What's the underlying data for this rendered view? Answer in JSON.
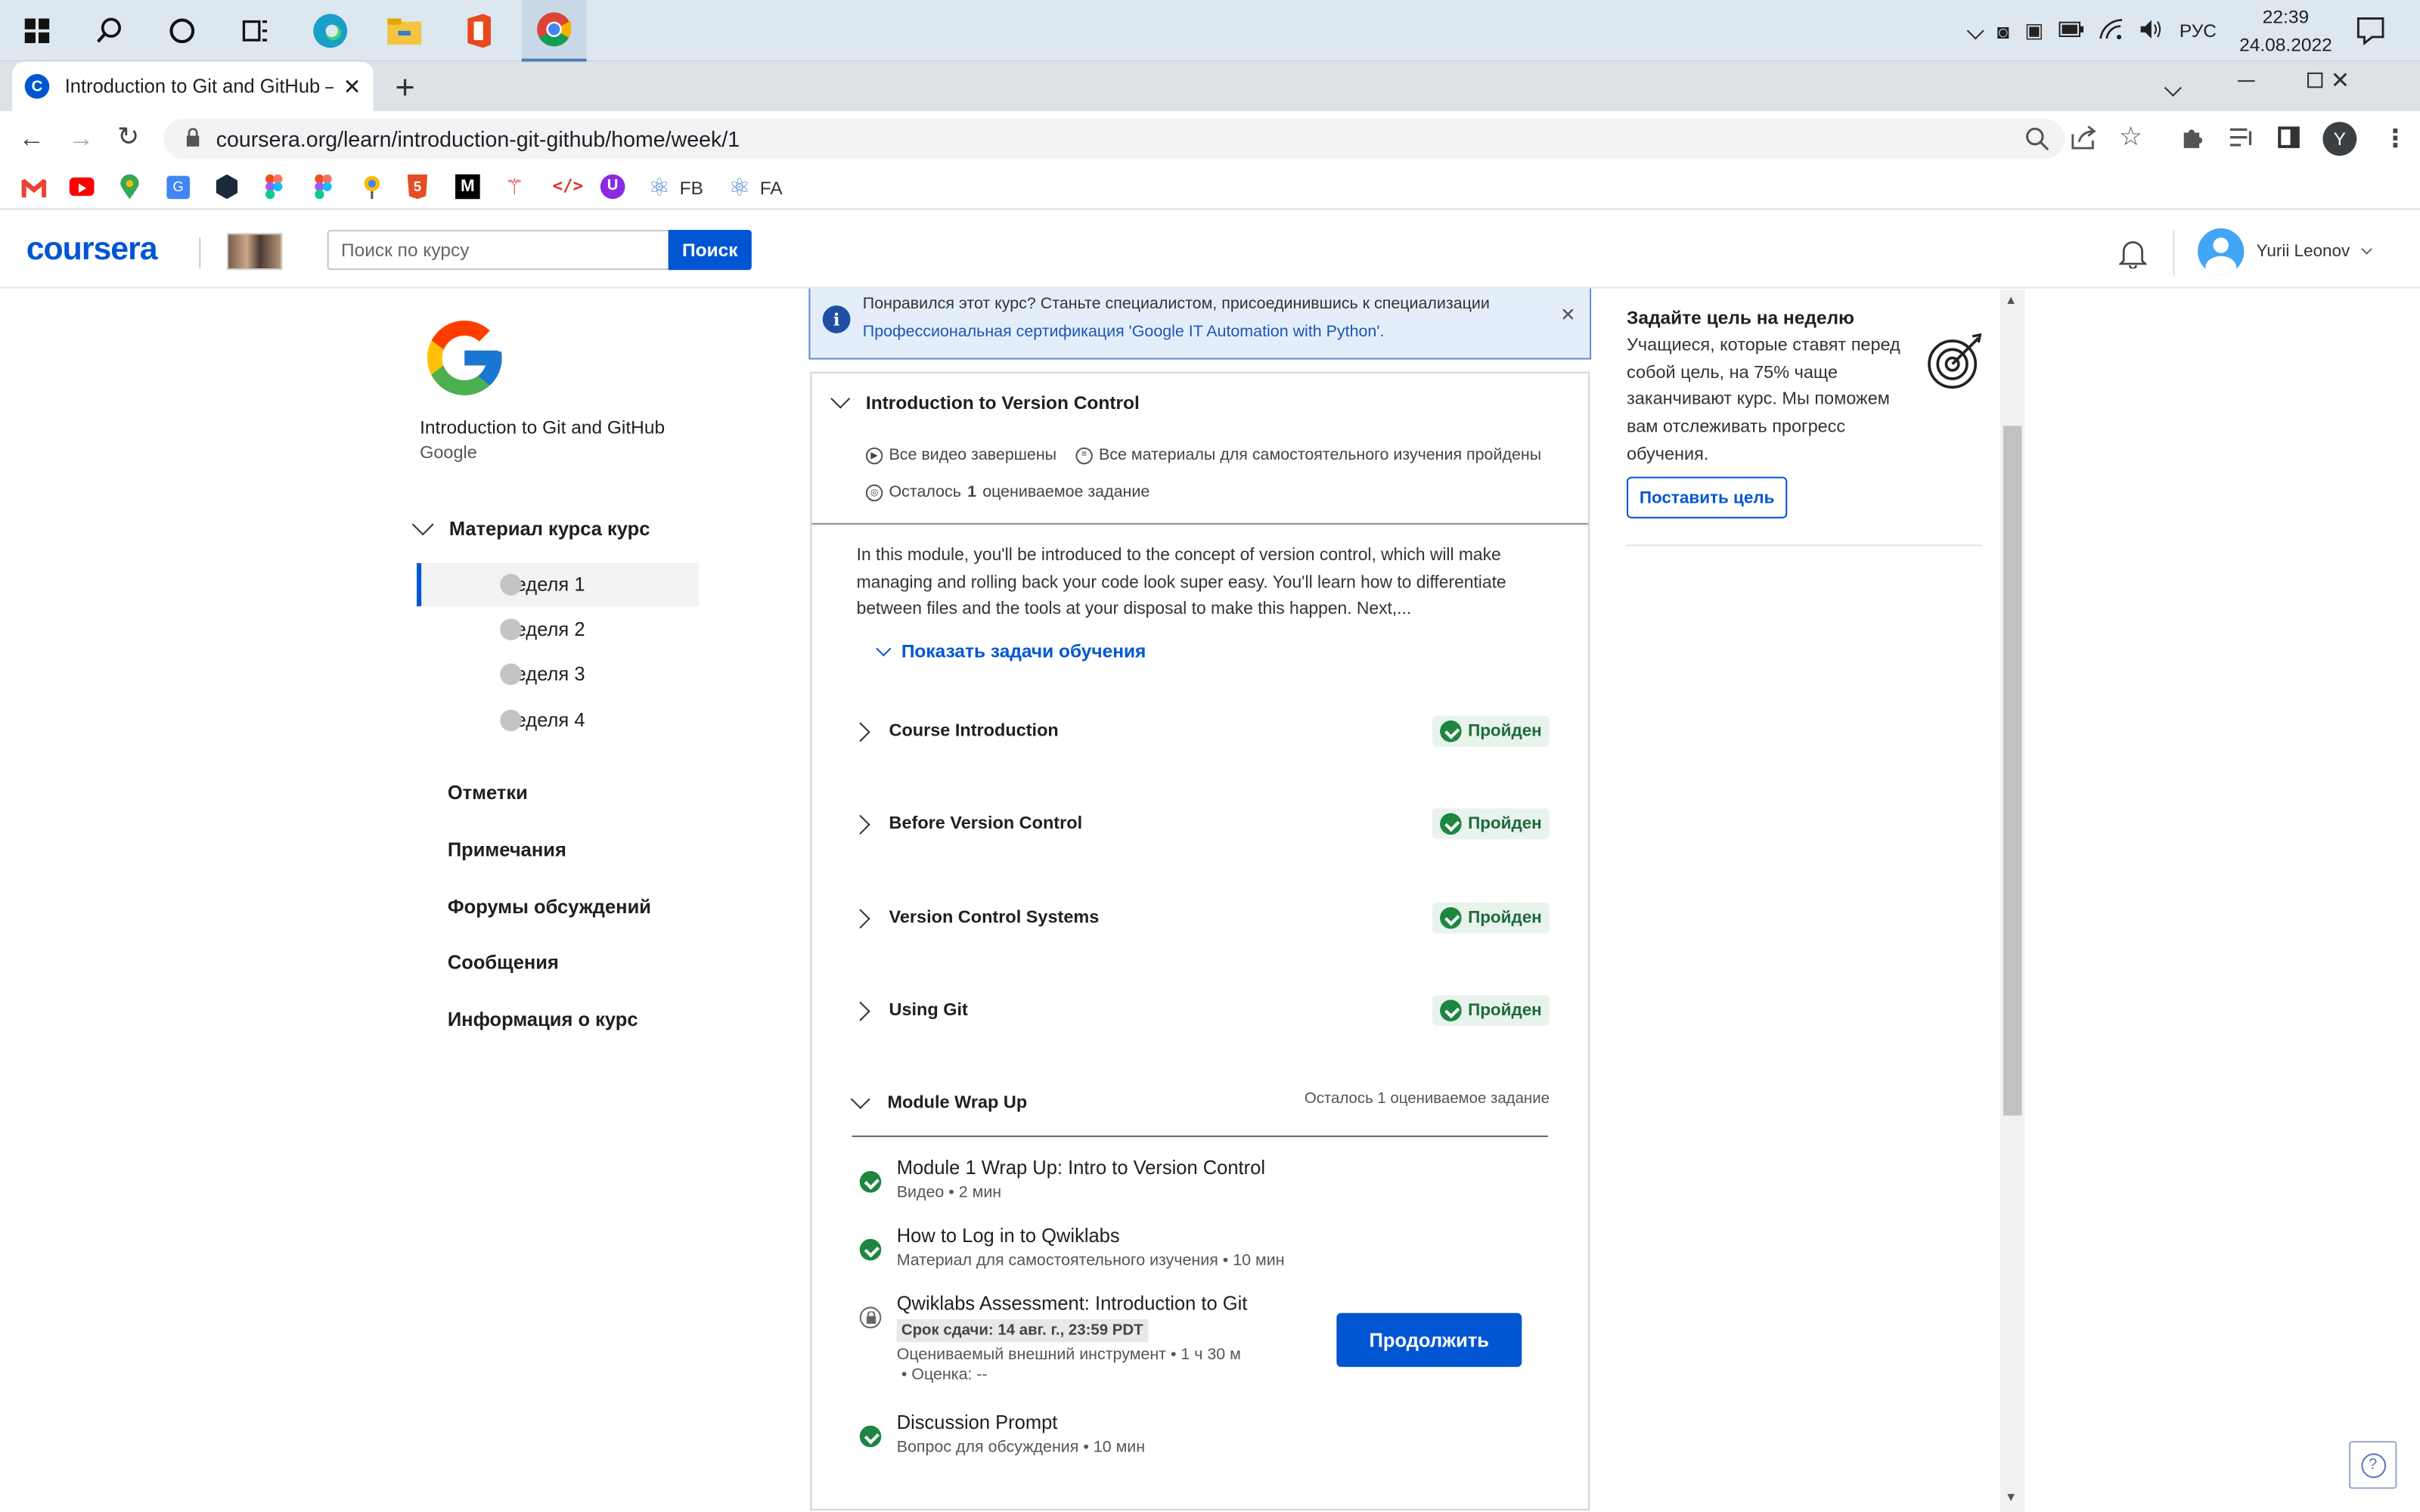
{
  "taskbar": {
    "language": "РУС",
    "time": "22:39",
    "date": "24.08.2022"
  },
  "browser": {
    "tab_title": "Introduction to Git and GitHub –",
    "url": "coursera.org/learn/introduction-git-github/home/week/1",
    "profile_initial": "Y",
    "bookmarks": [
      {
        "icon": "gmail-icon",
        "label": ""
      },
      {
        "icon": "youtube-icon",
        "label": ""
      },
      {
        "icon": "maps-icon",
        "label": ""
      },
      {
        "icon": "translate-icon",
        "label": ""
      },
      {
        "icon": "codepen-icon",
        "label": ""
      },
      {
        "icon": "figma-icon",
        "label": ""
      },
      {
        "icon": "figma-icon",
        "label": ""
      },
      {
        "icon": "pin-icon",
        "label": ""
      },
      {
        "icon": "html5-icon",
        "label": ""
      },
      {
        "icon": "medium-icon",
        "label": ""
      },
      {
        "icon": "figure-icon",
        "label": ""
      },
      {
        "icon": "code-icon",
        "label": ""
      },
      {
        "icon": "u-icon",
        "label": ""
      },
      {
        "icon": "react-icon",
        "label": "FB"
      },
      {
        "icon": "react-icon",
        "label": "FA"
      }
    ]
  },
  "header": {
    "logo": "coursera",
    "search_placeholder": "Поиск по курсу",
    "search_button": "Поиск",
    "user_name": "Yurii Leonov"
  },
  "sidebar": {
    "course_title": "Introduction to Git and GitHub",
    "provider": "Google",
    "material_heading": "Материал курса курс",
    "weeks": [
      "Неделя 1",
      "Неделя 2",
      "Неделя 3",
      "Неделя 4"
    ],
    "links": [
      "Отметки",
      "Примечания",
      "Форумы обсуждений",
      "Сообщения",
      "Информация о курс"
    ]
  },
  "banner": {
    "line1": "Понравился этот курс? Станьте специалистом, присоединившись к специализации",
    "line2": "Профессиональная сертификация 'Google IT Automation with Python'."
  },
  "module": {
    "title": "Introduction to Version Control",
    "status_videos": "Все видео завершены",
    "status_readings": "Все материалы для самостоятельного изучения пройдены",
    "status_remaining_prefix": "Осталось",
    "status_remaining_count": "1",
    "status_remaining_suffix": "оцениваемое задание",
    "description": "In this module, you'll be introduced to the concept of version control, which will make managing and rolling back your code look super easy. You'll learn how to differentiate between files and the tools at your disposal to make this happen. Next,...",
    "show_objectives": "Показать задачи обучения",
    "lessons": [
      {
        "title": "Course Introduction",
        "status": "Пройден"
      },
      {
        "title": "Before Version Control",
        "status": "Пройден"
      },
      {
        "title": "Version Control Systems",
        "status": "Пройден"
      },
      {
        "title": "Using Git",
        "status": "Пройден"
      }
    ],
    "wrapup": {
      "title": "Module Wrap Up",
      "remaining": "Осталось 1 оцениваемое задание",
      "items": [
        {
          "title": "Module 1 Wrap Up: Intro to Version Control",
          "sub": "Видео • 2 мин"
        },
        {
          "title": "How to Log in to Qwiklabs",
          "sub": "Материал для самостоятельного изучения • 10 мин"
        },
        {
          "title": "Qwiklabs Assessment: Introduction to Git",
          "deadline": "Срок сдачи: 14 авг. г., 23:59 PDT",
          "sub": "Оцениваемый внешний инструмент • 1 ч 30 м",
          "grade": "• Оценка: --"
        },
        {
          "title": "Discussion Prompt",
          "sub": "Вопрос для обсуждения • 10 мин"
        }
      ],
      "continue_button": "Продолжить"
    }
  },
  "goal": {
    "title": "Задайте цель на неделю",
    "text": "Учащиеся, которые ставят перед собой цель, на 75% чаще заканчивают курс. Мы поможем вам отслеживать прогресс обучения.",
    "button": "Поставить цель"
  }
}
